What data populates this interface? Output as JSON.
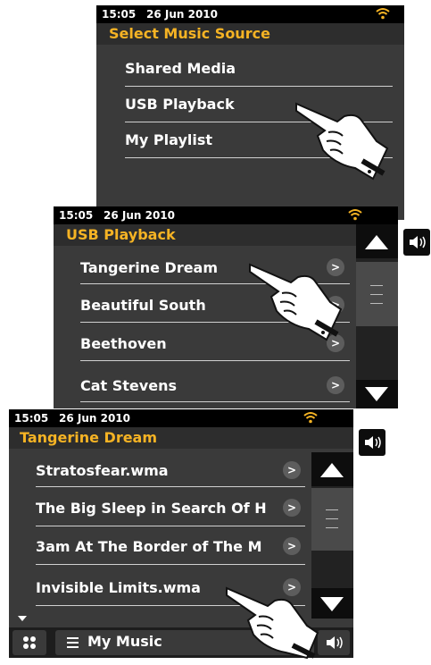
{
  "screens": [
    {
      "status": {
        "time": "15:05",
        "date": "26 Jun 2010"
      },
      "title": "Select Music Source",
      "items": [
        "Shared Media",
        "USB Playback",
        "My Playlist"
      ]
    },
    {
      "status": {
        "time": "15:05",
        "date": "26 Jun 2010"
      },
      "title": "USB Playback",
      "items": [
        "Tangerine Dream",
        "Beautiful South",
        "Beethoven",
        "Cat Stevens"
      ]
    },
    {
      "status": {
        "time": "15:05",
        "date": "26 Jun 2010"
      },
      "title": "Tangerine Dream",
      "items": [
        "Stratosfear.wma",
        "The Big Sleep in Search Of H",
        "3am At The Border of The M",
        "Invisible Limits.wma"
      ],
      "bottom_label": "My Music"
    }
  ],
  "chevron_glyph": ">",
  "icons": {
    "wifi": "wifi-icon",
    "volume": "volume-icon",
    "scroll_up": "arrow-up-icon",
    "scroll_down": "arrow-down-icon",
    "grid": "grid-icon",
    "menu": "menu-icon",
    "pointer": "hand-pointer-icon"
  },
  "colors": {
    "title": "#f5b324",
    "wifi": "#f5b324",
    "screen_bg": "#3a3a3a",
    "statusbar_bg": "#000000"
  }
}
